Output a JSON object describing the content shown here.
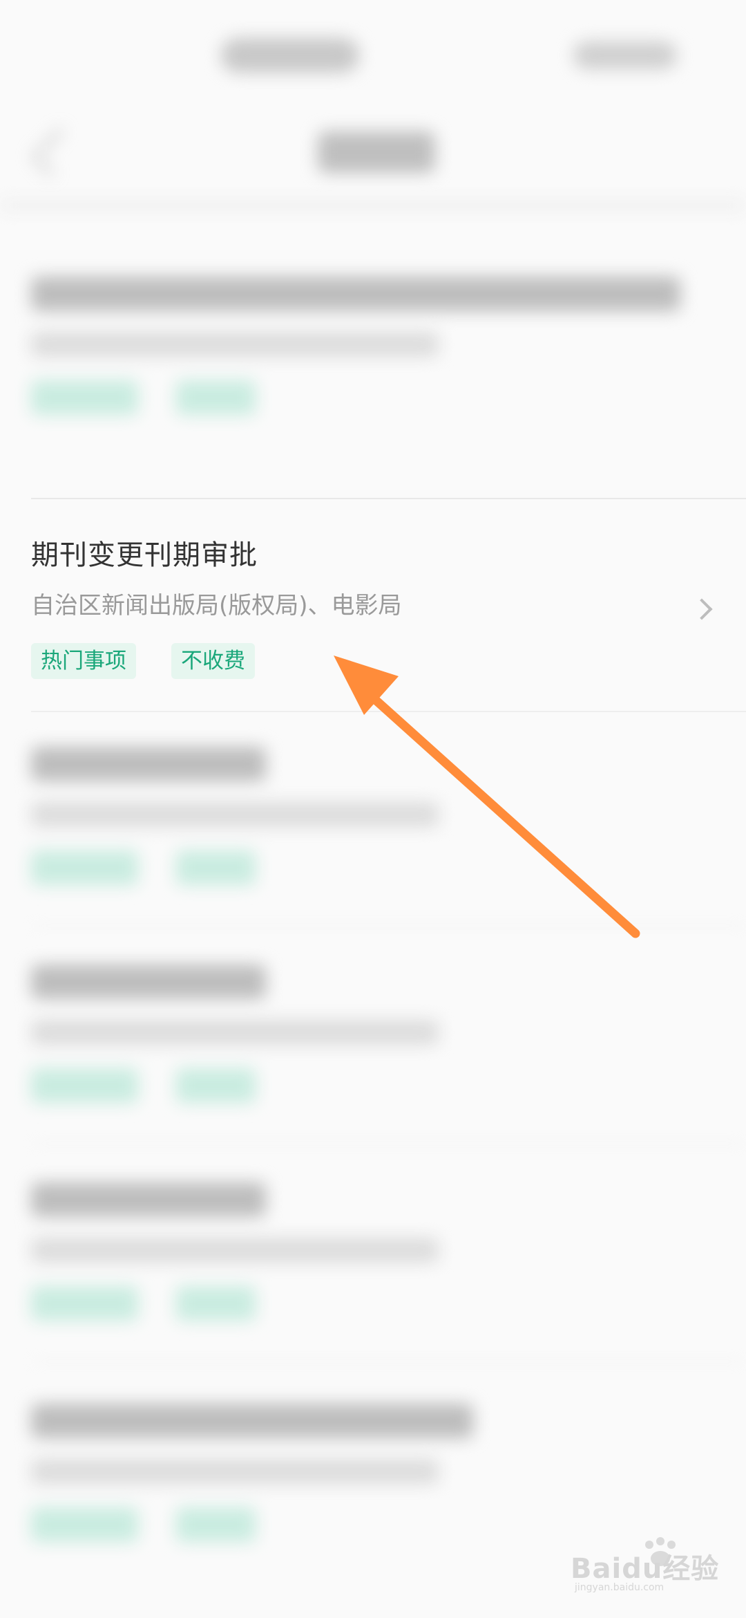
{
  "item": {
    "title": "期刊变更刊期审批",
    "department": "自治区新闻出版局(版权局)、电影局",
    "tags": [
      "热门事项",
      "不收费"
    ]
  },
  "colors": {
    "tag_bg": "#e6f6ef",
    "tag_text": "#1aa77a",
    "arrow": "#ff8c3a"
  },
  "icons": {
    "chevron": "chevron-right-icon",
    "back": "back-arrow-icon"
  },
  "watermark": {
    "brand": "Baidu经验",
    "url": "jingyan.baidu.com"
  }
}
